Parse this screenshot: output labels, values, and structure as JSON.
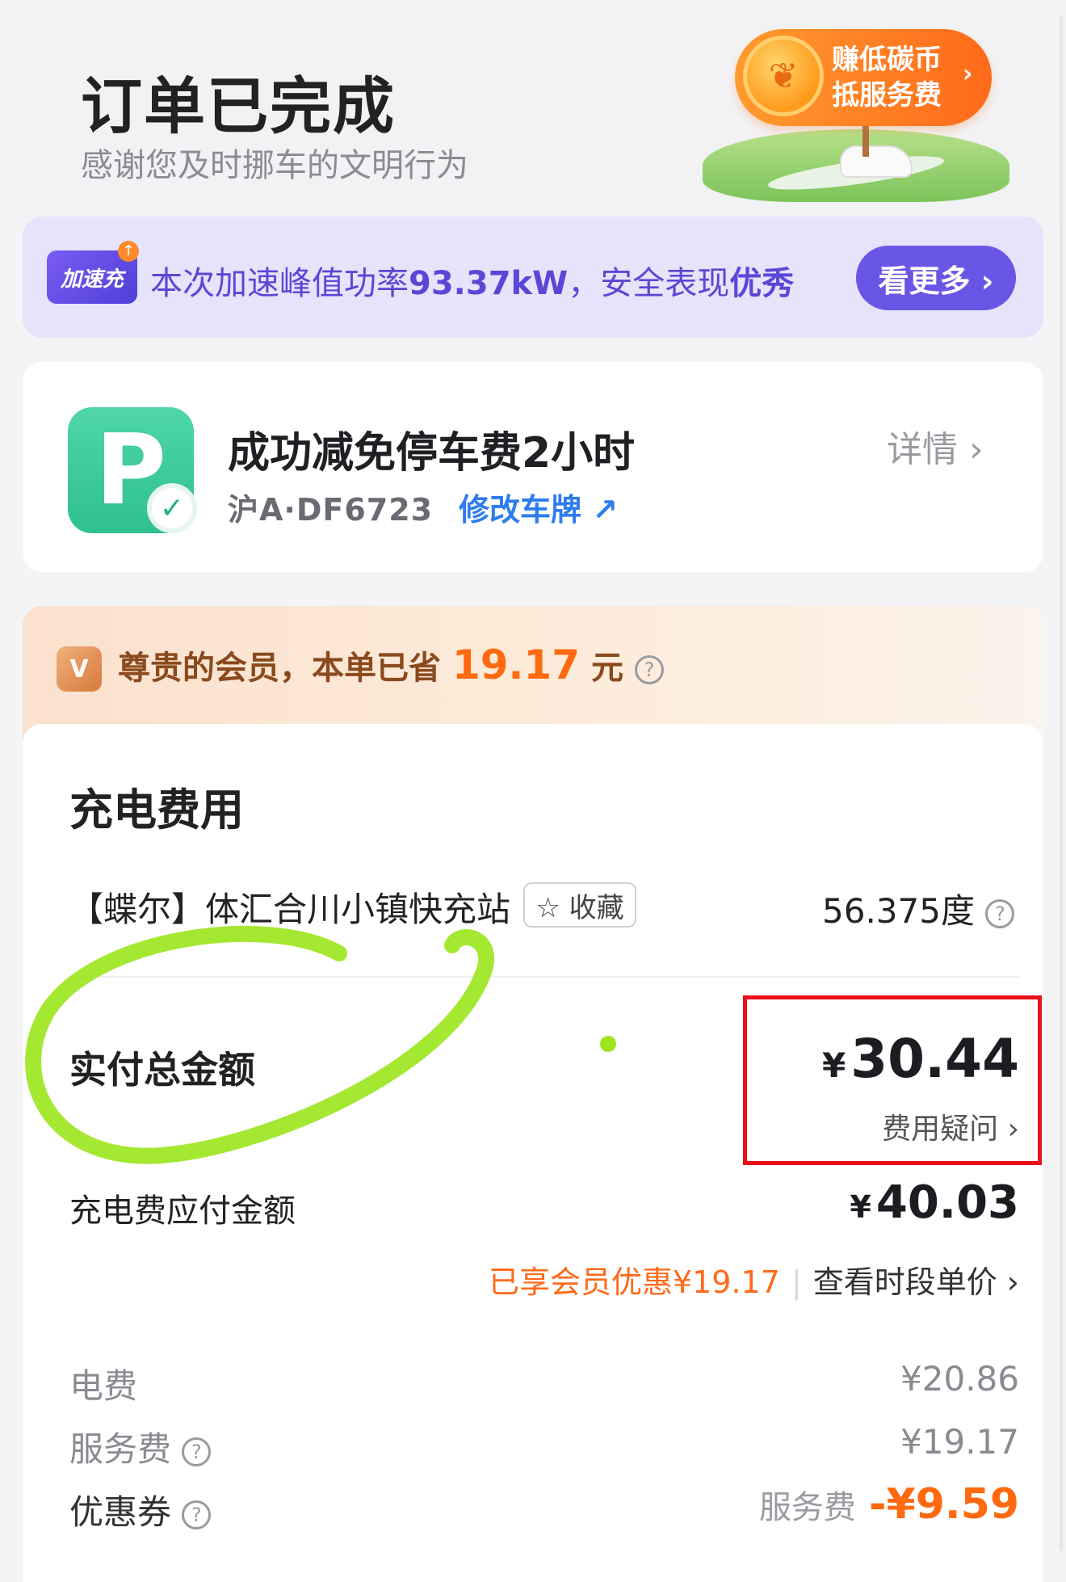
{
  "header": {
    "title": "订单已完成",
    "subtitle": "感谢您及时挪车的文明行为"
  },
  "promo": {
    "text": "赚低碳币抵服务费",
    "chevron": "›"
  },
  "boost": {
    "badge": "加速充",
    "text_prefix": "本次加速峰值功率",
    "peak_power": "93.37kW",
    "text_middle": "，安全表现",
    "rating": "优秀",
    "button_label": "看更多 ›"
  },
  "parking": {
    "icon_letter": "P",
    "title": "成功减免停车费2小时",
    "plate": "沪A·DF6723",
    "edit_label": "修改车牌 ↗",
    "detail_label": "详情 ›"
  },
  "member": {
    "text_prefix": "尊贵的会员，本单已省",
    "saved_amount": "19.17",
    "unit": "元",
    "help": "?"
  },
  "fees": {
    "title": "充电费用",
    "station_name": "【蝶尔】体汇合川小镇快充站",
    "favorite_label": "☆ 收藏",
    "energy": "56.375度",
    "help": "?",
    "total_label": "实付总金额",
    "currency": "¥",
    "total_amount": "30.44",
    "fee_query_label": "费用疑问 ›",
    "payable_label": "充电费应付金额",
    "payable_amount": "40.03",
    "member_discount": "已享会员优惠¥19.17",
    "view_price_label": "查看时段单价 ›",
    "electricity_label": "电费",
    "electricity_value": "¥20.86",
    "service_label": "服务费",
    "service_value": "¥19.17",
    "coupon_label": "优惠券",
    "coupon_note": "服务费",
    "coupon_value": "-¥9.59"
  },
  "colors": {
    "accent_purple": "#6a56e6",
    "accent_orange": "#ff6a10",
    "highlight_red": "#e8101a",
    "annotation_green": "#9be61c"
  }
}
